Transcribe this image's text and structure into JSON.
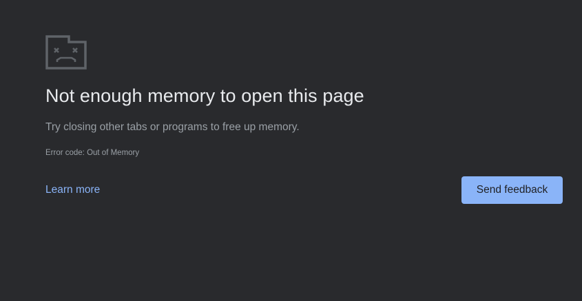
{
  "icon": {
    "name": "sad-tab-icon",
    "color": "#5f6368"
  },
  "error_page": {
    "title": "Not enough memory to open this page",
    "message": "Try closing other tabs or programs to free up memory.",
    "error_code": "Error code: Out of Memory",
    "learn_more_label": "Learn more",
    "send_feedback_label": "Send feedback"
  },
  "colors": {
    "background": "#292a2d",
    "title": "#e8eaed",
    "secondary_text": "#9aa0a6",
    "link": "#8ab4f8",
    "button_background": "#8ab4f8",
    "button_text": "#202124"
  }
}
